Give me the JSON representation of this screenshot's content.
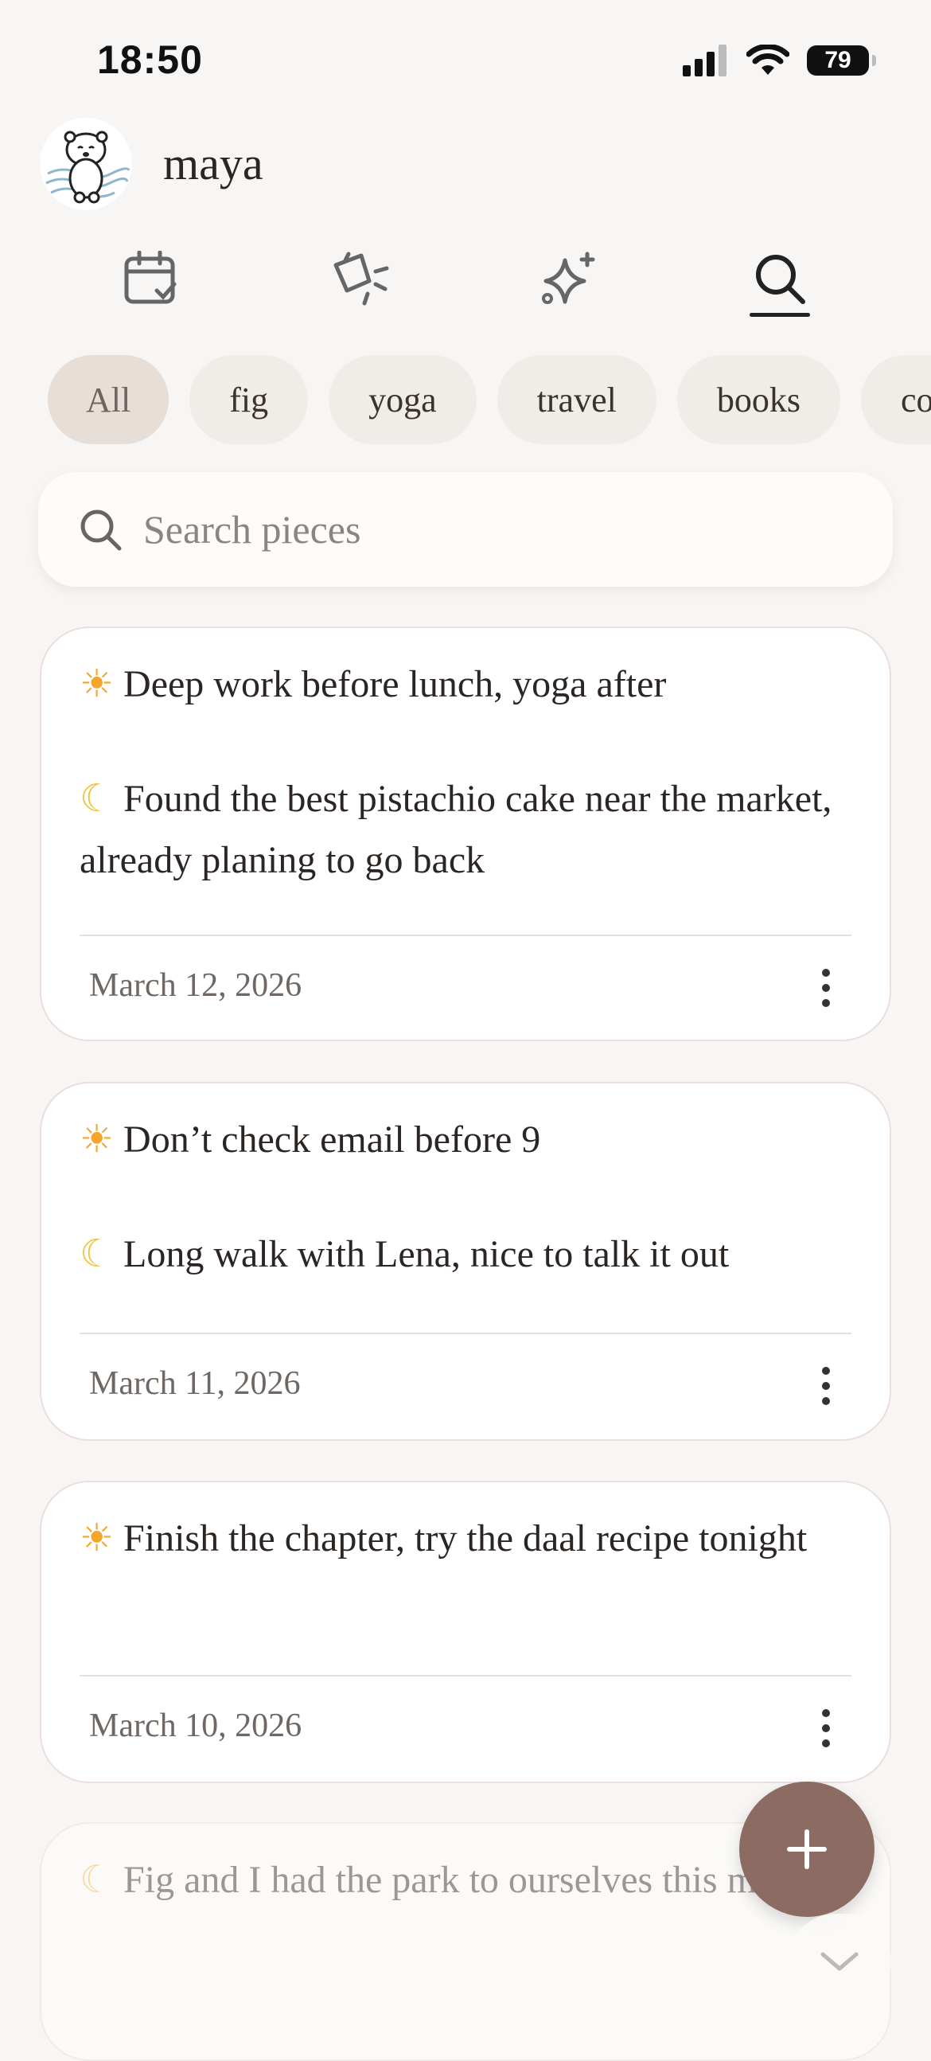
{
  "status_bar": {
    "time": "18:50",
    "battery": "79"
  },
  "header": {
    "username": "maya"
  },
  "nav": {
    "tabs": [
      {
        "name": "calendar"
      },
      {
        "name": "broom"
      },
      {
        "name": "sparkles"
      },
      {
        "name": "search",
        "active": true
      }
    ]
  },
  "filters": {
    "chips": [
      "All",
      "fig",
      "yoga",
      "travel",
      "books",
      "co"
    ]
  },
  "search": {
    "placeholder": "Search pieces"
  },
  "entries": [
    {
      "morning": "Deep work before lunch, yoga after",
      "evening": "Found the best pistachio cake near the market, already planing to go back",
      "date": "March 12, 2026"
    },
    {
      "morning": "Don’t check email before 9",
      "evening": "Long walk with Lena, nice to talk it out",
      "date": "March 11, 2026"
    },
    {
      "morning": "Finish the chapter, try the daal recipe tonight",
      "date": "March 10, 2026"
    },
    {
      "evening": "Fig and I had the park to ourselves this morning"
    }
  ],
  "icons": {
    "sun": "☀",
    "moon": "☾",
    "add": "+",
    "chevron": "chevron-down-icon"
  },
  "colors": {
    "fab": "#8c6b62",
    "chip_active": "#e7dfd7",
    "background": "#f8f6f4"
  }
}
